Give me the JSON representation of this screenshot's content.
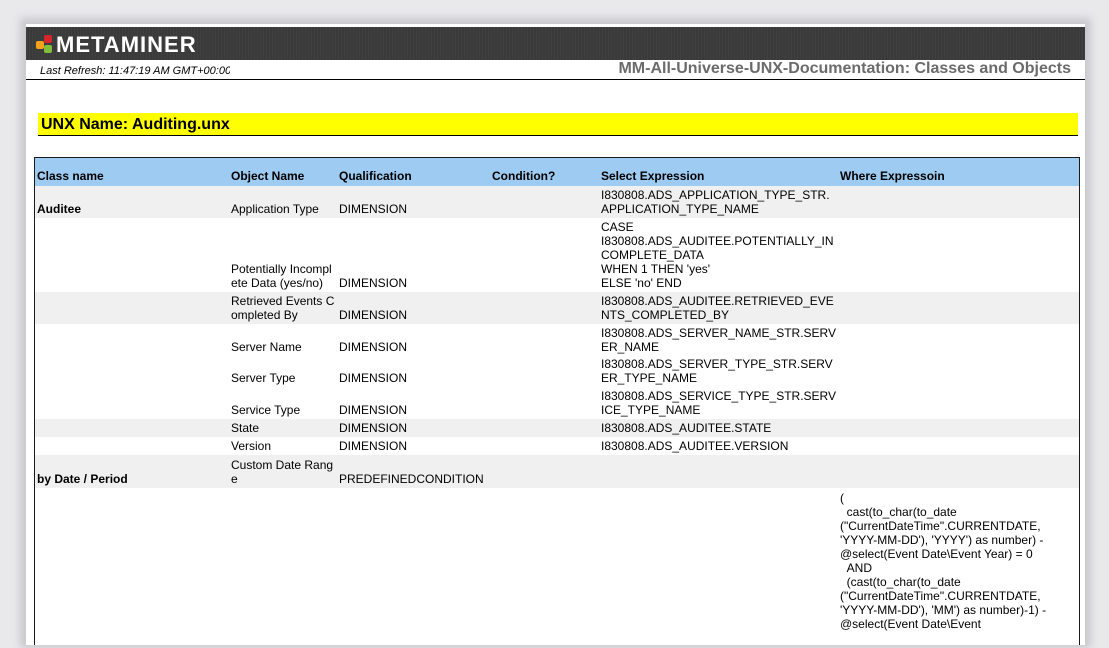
{
  "header": {
    "logo_text": "METAMINER",
    "last_refresh": "Last Refresh: 11:47:19 AM GMT+00:00",
    "doc_title": "MM-All-Universe-UNX-Documentation: Classes and Objects"
  },
  "unx_name": "UNX Name: Auditing.unx",
  "table": {
    "columns": [
      "Class name",
      "Object Name",
      "Qualification",
      "Condition?",
      "Select Expression",
      "Where Expressoin"
    ],
    "rows": [
      {
        "class": "Auditee",
        "object": "Application Type",
        "qual": "DIMENSION",
        "cond": "",
        "select": "I830808.ADS_APPLICATION_TYPE_STR.APPLICATION_TYPE_NAME",
        "where": ""
      },
      {
        "class": "",
        "object": "Potentially Incomplete Data (yes/no)",
        "qual": "DIMENSION",
        "cond": "",
        "select": "CASE\nI830808.ADS_AUDITEE.POTENTIALLY_INCOMPLETE_DATA\nWHEN 1 THEN 'yes'\nELSE 'no' END",
        "where": ""
      },
      {
        "class": "",
        "object": "Retrieved Events Completed By",
        "qual": "DIMENSION",
        "cond": "",
        "select": "I830808.ADS_AUDITEE.RETRIEVED_EVENTS_COMPLETED_BY",
        "where": ""
      },
      {
        "class": "",
        "object": "Server Name",
        "qual": "DIMENSION",
        "cond": "",
        "select": "I830808.ADS_SERVER_NAME_STR.SERVER_NAME",
        "where": ""
      },
      {
        "class": "",
        "object": "Server Type",
        "qual": "DIMENSION",
        "cond": "",
        "select": "I830808.ADS_SERVER_TYPE_STR.SERVER_TYPE_NAME",
        "where": ""
      },
      {
        "class": "",
        "object": "Service Type",
        "qual": "DIMENSION",
        "cond": "",
        "select": "I830808.ADS_SERVICE_TYPE_STR.SERVICE_TYPE_NAME",
        "where": ""
      },
      {
        "class": "",
        "object": "State",
        "qual": "DIMENSION",
        "cond": "",
        "select": "I830808.ADS_AUDITEE.STATE",
        "where": ""
      },
      {
        "class": "",
        "object": "Version",
        "qual": "DIMENSION",
        "cond": "",
        "select": "I830808.ADS_AUDITEE.VERSION",
        "where": ""
      },
      {
        "class": "by Date / Period",
        "object": "Custom Date Range",
        "qual": "PREDEFINEDCONDITION",
        "cond": "",
        "select": "",
        "where": ""
      },
      {
        "class": "",
        "object": "",
        "qual": "",
        "cond": "",
        "select": "",
        "where": "(\n  cast(to_char(to_date\n(\"CurrentDateTime\".CURRENTDATE,\n'YYYY-MM-DD'), 'YYYY') as number) -\n@select(Event Date\\Event Year) = 0\n  AND\n  (cast(to_char(to_date\n(\"CurrentDateTime\".CURRENTDATE,\n'YYYY-MM-DD'), 'MM') as number)-1) -\n@select(Event Date\\Event"
      }
    ]
  }
}
